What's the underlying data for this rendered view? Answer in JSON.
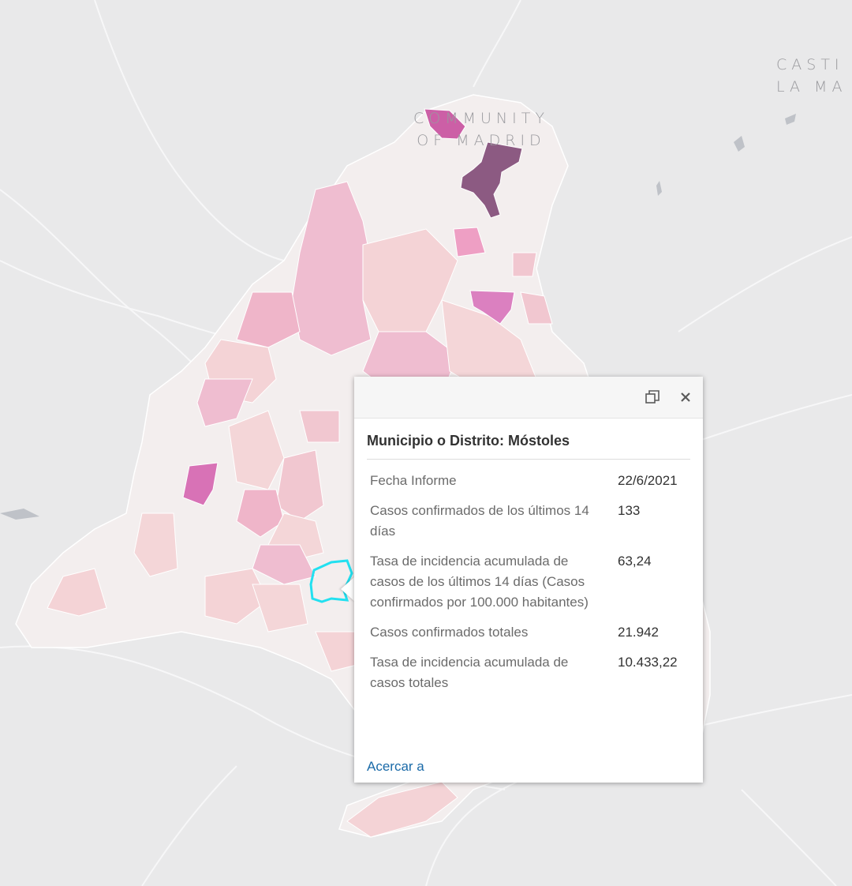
{
  "map": {
    "region_label_line1": "COMMUNITY",
    "region_label_line2": "OF MADRID",
    "neighbor_label_line1": "CASTI",
    "neighbor_label_line2": "LA MA"
  },
  "popup": {
    "title": "Municipio o Distrito: Móstoles",
    "rows": [
      {
        "label": "Fecha Informe",
        "value": "22/6/2021"
      },
      {
        "label": "Casos confirmados de los últimos 14 días",
        "value": "133"
      },
      {
        "label": "Tasa de incidencia acumulada de casos de los últimos 14 días (Casos confirmados por 100.000 habitantes)",
        "value": "63,24"
      },
      {
        "label": "Casos confirmados totales",
        "value": "21.942"
      },
      {
        "label": "Tasa de incidencia acumulada de casos totales",
        "value": "10.433,22"
      }
    ],
    "zoom_link": "Acercar a",
    "maximize_icon": "maximize-icon",
    "close_icon": "close-icon"
  },
  "colors": {
    "background": "#e9e9ea",
    "region_base": "#f3eeee",
    "highlight_outline": "#22e0f0",
    "choropleth_light": "#f4d6d8",
    "choropleth_mid": "#efb5c9",
    "choropleth_magenta": "#d777b9",
    "choropleth_dark": "#8c5a82",
    "link": "#1a6aa8"
  }
}
